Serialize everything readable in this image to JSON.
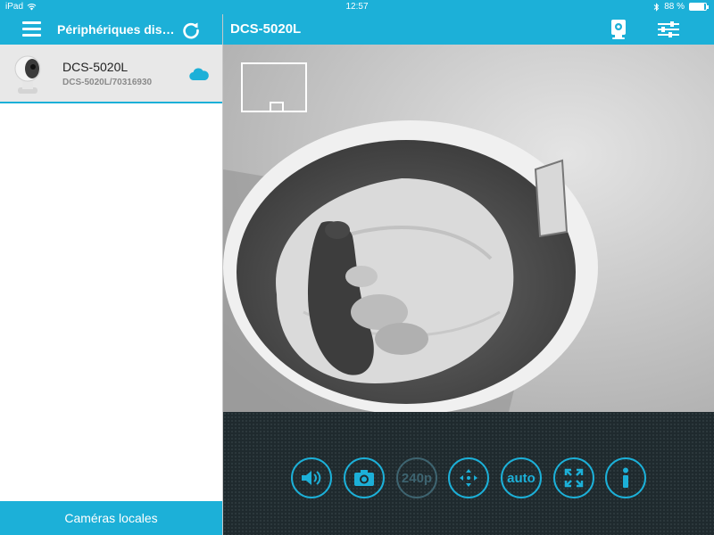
{
  "status_bar": {
    "device": "iPad",
    "time": "12:57",
    "battery": "88 %",
    "battery_level": 0.88
  },
  "sidebar": {
    "title": "Périphériques dis…",
    "devices": [
      {
        "name": "DCS-5020L",
        "id": "DCS-5020L/70316930"
      }
    ],
    "footer_label": "Caméras locales"
  },
  "main": {
    "title": "DCS-5020L"
  },
  "controls": {
    "resolution_label": "240p",
    "auto_label": "auto"
  },
  "colors": {
    "accent": "#1cb0d8",
    "control_bar": "#1f2a2e"
  },
  "icons": [
    "wifi-icon",
    "bluetooth-icon",
    "battery-icon",
    "menu-icon",
    "refresh-icon",
    "cloud-icon",
    "camera-view-icon",
    "settings-sliders-icon",
    "speaker-icon",
    "snapshot-icon",
    "pan-tilt-icon",
    "fullscreen-icon",
    "info-icon"
  ]
}
